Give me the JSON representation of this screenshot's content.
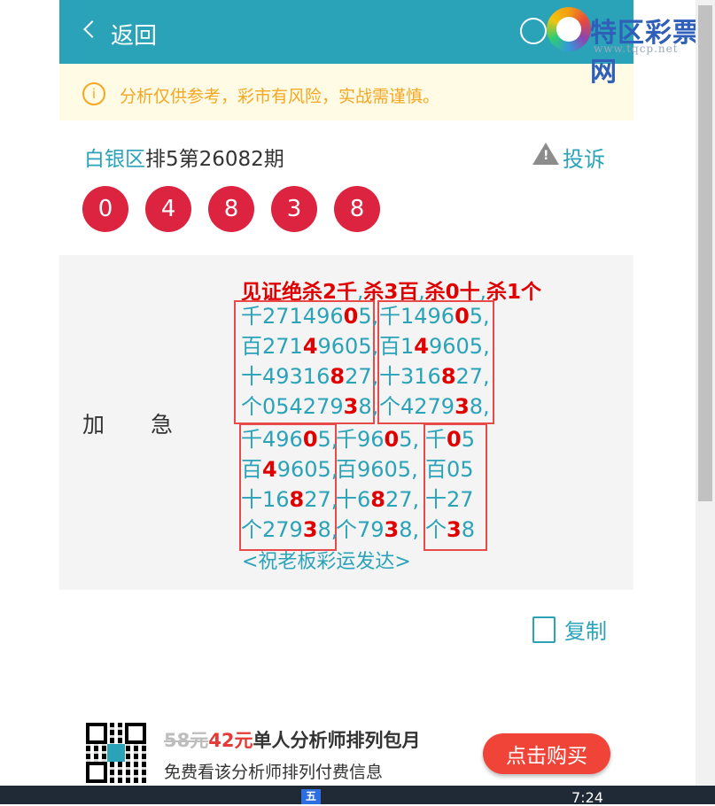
{
  "header": {
    "back_label": "返回",
    "logo_text": "特区彩票网",
    "logo_url": "www.tqcp.net"
  },
  "notice": {
    "icon": "info-icon",
    "text": "分析仅供参考，彩市有风险，实战需谨慎。"
  },
  "issue": {
    "area": "白银区",
    "title": "排5第26082期",
    "complain_label": "投诉"
  },
  "balls": [
    "0",
    "4",
    "8",
    "3",
    "8"
  ],
  "content": {
    "label_1": "加",
    "label_2": "急",
    "headline": [
      "见证绝杀2千",
      "杀3百",
      "杀0十",
      "杀1个"
    ],
    "group_a": [
      [
        "千271496",
        "0",
        "5,"
      ],
      [
        "百271",
        "4",
        "9605,"
      ],
      [
        "十49316",
        "8",
        "27,"
      ],
      [
        "个054279",
        "3",
        "8,"
      ]
    ],
    "group_b": [
      [
        "千1496",
        "0",
        "5,"
      ],
      [
        "百1",
        "4",
        "9605,"
      ],
      [
        "十316",
        "8",
        "27,"
      ],
      [
        "个4279",
        "3",
        "8,"
      ]
    ],
    "group_c": [
      [
        "千496",
        "0",
        "5,"
      ],
      [
        "百",
        "4",
        "9605,"
      ],
      [
        "十16",
        "8",
        "27,"
      ],
      [
        "个279",
        "3",
        "8,"
      ]
    ],
    "group_d": [
      [
        "千96",
        "0",
        "5,"
      ],
      [
        "百9605,",
        "",
        ""
      ],
      [
        "十6",
        "8",
        "27,"
      ],
      [
        "个79",
        "3",
        "8,"
      ]
    ],
    "group_e": [
      [
        "千",
        "0",
        "5"
      ],
      [
        "百05",
        "",
        ""
      ],
      [
        "十27",
        "",
        ""
      ],
      [
        "个",
        "3",
        "8"
      ]
    ],
    "blessing": "<祝老板彩运发达>"
  },
  "copy_label": "复制",
  "promo": {
    "old_price": "58元",
    "new_price": "42元",
    "title": "单人分析师排列包月",
    "subtitle": "免费看该分析师排列付费信息",
    "buy_label": "点击购买"
  },
  "taskbar": {
    "time": "7:24",
    "ime": "五"
  },
  "colors": {
    "header": "#2aa3b9",
    "ball": "#dc2440",
    "highlight": "#e00000"
  }
}
